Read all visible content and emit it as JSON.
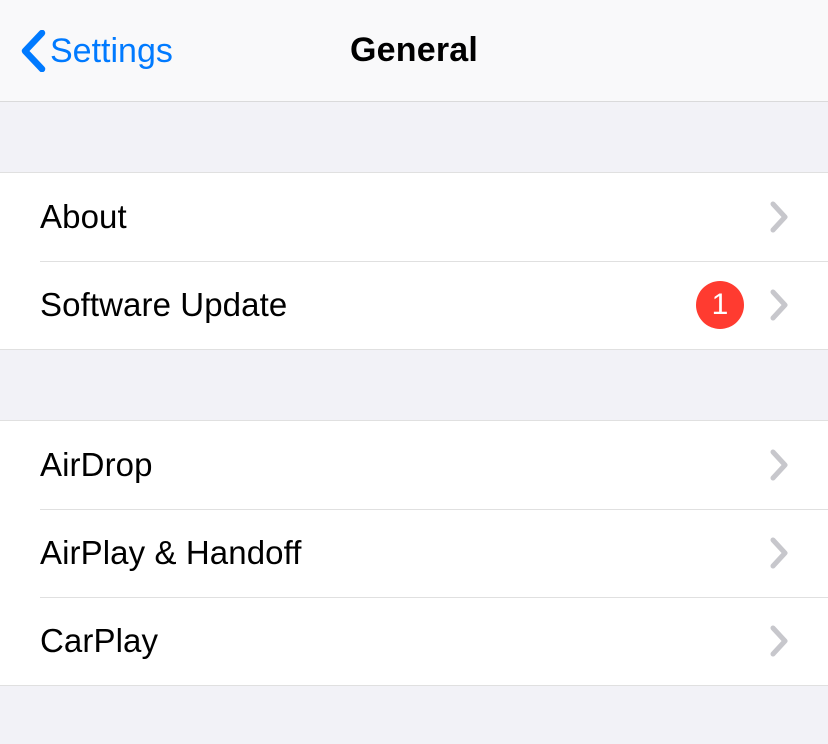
{
  "nav": {
    "back_label": "Settings",
    "title": "General"
  },
  "groups": [
    {
      "rows": [
        {
          "id": "about",
          "label": "About"
        },
        {
          "id": "software-update",
          "label": "Software Update",
          "badge": "1"
        }
      ]
    },
    {
      "rows": [
        {
          "id": "airdrop",
          "label": "AirDrop"
        },
        {
          "id": "airplay-handoff",
          "label": "AirPlay & Handoff"
        },
        {
          "id": "carplay",
          "label": "CarPlay"
        }
      ]
    }
  ],
  "colors": {
    "tint": "#007aff",
    "badge": "#ff3b30",
    "separator": "rgba(0,0,0,0.12)",
    "groupBg": "#f2f2f7",
    "chevron": "#c7c7cc"
  }
}
